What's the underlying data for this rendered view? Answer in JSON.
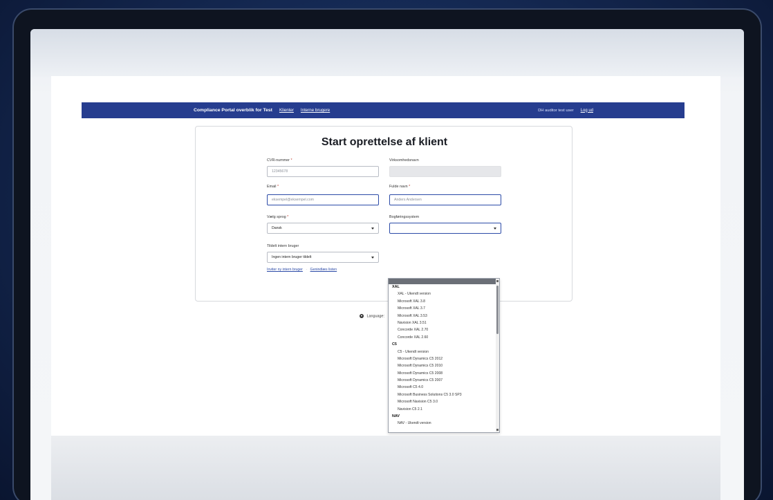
{
  "navbar": {
    "brand": "Compliance Portal overblik for Test",
    "links": [
      "Klienter",
      "Interne brugere"
    ],
    "user": "DH auditor test user",
    "logout": "Log ud"
  },
  "card": {
    "title": "Start oprettelse af klient",
    "cvr_label": "CVR-nummer",
    "cvr_placeholder": "12345678",
    "company_label": "Virksomhedsnavn",
    "company_value": "",
    "email_label": "Email",
    "email_placeholder": "eksempel@eksempel.com",
    "name_label": "Fulde navn",
    "name_placeholder": "Anders Andersen",
    "language_label": "Vælg sprog",
    "language_value": "Dansk",
    "accounting_label": "Bogføringssystem",
    "accounting_value": "",
    "assign_label": "Tildelt intern bruger",
    "assign_value": "Ingen intern bruger tildelt",
    "invite_link": "Inviter ny intern bruger",
    "refresh_link": "Genindlæs listen",
    "required_mark": "*"
  },
  "footer": {
    "language_label": "Language:"
  },
  "dropdown": {
    "groups": [
      {
        "name": "XAL",
        "items": [
          "XAL - Ukendt version",
          "Microsoft XAL 3.8",
          "Microsoft XAL 3.7",
          "Microsoft XAL 3.53",
          "Navision XAL 3.51",
          "Concorde XAL 2.70",
          "Concorde XAL 2.60"
        ]
      },
      {
        "name": "C5",
        "items": [
          "C5 - Ukendt version",
          "Microsoft Dynamics C5 2012",
          "Microsoft Dynamics C5 2010",
          "Microsoft Dynamics C5 2008",
          "Microsoft Dynamics C5 2007",
          "Microsoft C5 4.0",
          "Microsoft Business Solutions C5 3.0 SP3",
          "Microsoft Navision C5 3.0",
          "Navision C5 2.1"
        ]
      },
      {
        "name": "NAV",
        "items": [
          "NAV - Ukendt version"
        ]
      }
    ]
  }
}
